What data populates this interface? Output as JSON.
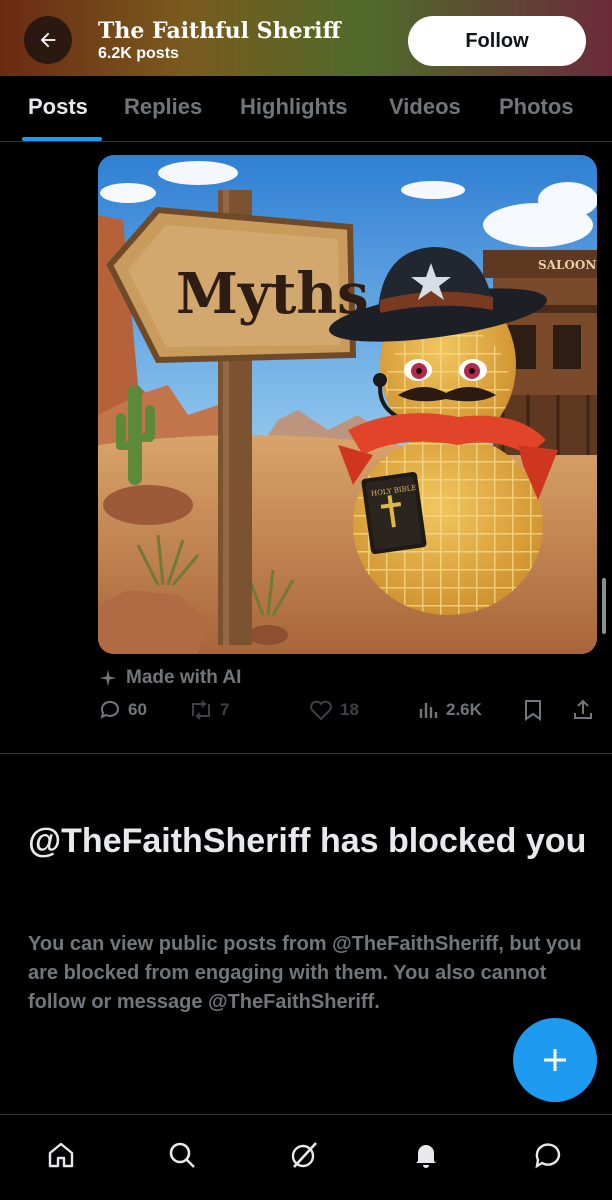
{
  "header": {
    "title": "The Faithful Sheriff",
    "post_count": "6.2K posts",
    "follow_label": "Follow",
    "back_icon": "arrow-left-icon"
  },
  "tabs": [
    {
      "label": "Posts",
      "active": true
    },
    {
      "label": "Replies",
      "active": false
    },
    {
      "label": "Highlights",
      "active": false
    },
    {
      "label": "Videos",
      "active": false
    },
    {
      "label": "Photos",
      "active": false
    }
  ],
  "post": {
    "image": {
      "sign_text": "Myths",
      "book_text": "HOLY BIBLE",
      "saloon_text": "SALOON"
    },
    "ai_label": "Made with AI",
    "stats": {
      "replies": "60",
      "reposts": "7",
      "likes": "18",
      "views": "2.6K"
    }
  },
  "blocked": {
    "title": "@TheFaithSheriff has blocked you",
    "description": "You can view public posts from @TheFaithSheriff, but you are blocked from engaging with them. You also cannot follow or message @TheFaithSheriff."
  },
  "fab_icon": "plus-icon",
  "bottom_nav": {
    "items": [
      "home-icon",
      "search-icon",
      "grok-icon",
      "notifications-icon",
      "messages-icon"
    ]
  },
  "colors": {
    "accent": "#1d9bf0",
    "background": "#000000",
    "text_primary": "#e7e9ea",
    "text_secondary": "#71767b"
  }
}
